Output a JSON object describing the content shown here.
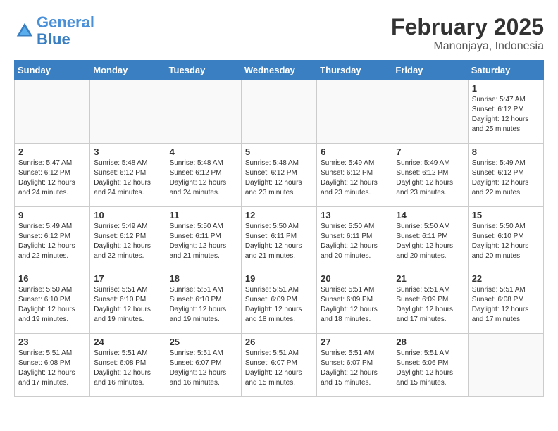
{
  "header": {
    "logo_line1": "General",
    "logo_line2": "Blue",
    "month": "February 2025",
    "location": "Manonjaya, Indonesia"
  },
  "days_of_week": [
    "Sunday",
    "Monday",
    "Tuesday",
    "Wednesday",
    "Thursday",
    "Friday",
    "Saturday"
  ],
  "weeks": [
    [
      {
        "day": "",
        "info": ""
      },
      {
        "day": "",
        "info": ""
      },
      {
        "day": "",
        "info": ""
      },
      {
        "day": "",
        "info": ""
      },
      {
        "day": "",
        "info": ""
      },
      {
        "day": "",
        "info": ""
      },
      {
        "day": "1",
        "info": "Sunrise: 5:47 AM\nSunset: 6:12 PM\nDaylight: 12 hours\nand 25 minutes."
      }
    ],
    [
      {
        "day": "2",
        "info": "Sunrise: 5:47 AM\nSunset: 6:12 PM\nDaylight: 12 hours\nand 24 minutes."
      },
      {
        "day": "3",
        "info": "Sunrise: 5:48 AM\nSunset: 6:12 PM\nDaylight: 12 hours\nand 24 minutes."
      },
      {
        "day": "4",
        "info": "Sunrise: 5:48 AM\nSunset: 6:12 PM\nDaylight: 12 hours\nand 24 minutes."
      },
      {
        "day": "5",
        "info": "Sunrise: 5:48 AM\nSunset: 6:12 PM\nDaylight: 12 hours\nand 23 minutes."
      },
      {
        "day": "6",
        "info": "Sunrise: 5:49 AM\nSunset: 6:12 PM\nDaylight: 12 hours\nand 23 minutes."
      },
      {
        "day": "7",
        "info": "Sunrise: 5:49 AM\nSunset: 6:12 PM\nDaylight: 12 hours\nand 23 minutes."
      },
      {
        "day": "8",
        "info": "Sunrise: 5:49 AM\nSunset: 6:12 PM\nDaylight: 12 hours\nand 22 minutes."
      }
    ],
    [
      {
        "day": "9",
        "info": "Sunrise: 5:49 AM\nSunset: 6:12 PM\nDaylight: 12 hours\nand 22 minutes."
      },
      {
        "day": "10",
        "info": "Sunrise: 5:49 AM\nSunset: 6:12 PM\nDaylight: 12 hours\nand 22 minutes."
      },
      {
        "day": "11",
        "info": "Sunrise: 5:50 AM\nSunset: 6:11 PM\nDaylight: 12 hours\nand 21 minutes."
      },
      {
        "day": "12",
        "info": "Sunrise: 5:50 AM\nSunset: 6:11 PM\nDaylight: 12 hours\nand 21 minutes."
      },
      {
        "day": "13",
        "info": "Sunrise: 5:50 AM\nSunset: 6:11 PM\nDaylight: 12 hours\nand 20 minutes."
      },
      {
        "day": "14",
        "info": "Sunrise: 5:50 AM\nSunset: 6:11 PM\nDaylight: 12 hours\nand 20 minutes."
      },
      {
        "day": "15",
        "info": "Sunrise: 5:50 AM\nSunset: 6:10 PM\nDaylight: 12 hours\nand 20 minutes."
      }
    ],
    [
      {
        "day": "16",
        "info": "Sunrise: 5:50 AM\nSunset: 6:10 PM\nDaylight: 12 hours\nand 19 minutes."
      },
      {
        "day": "17",
        "info": "Sunrise: 5:51 AM\nSunset: 6:10 PM\nDaylight: 12 hours\nand 19 minutes."
      },
      {
        "day": "18",
        "info": "Sunrise: 5:51 AM\nSunset: 6:10 PM\nDaylight: 12 hours\nand 19 minutes."
      },
      {
        "day": "19",
        "info": "Sunrise: 5:51 AM\nSunset: 6:09 PM\nDaylight: 12 hours\nand 18 minutes."
      },
      {
        "day": "20",
        "info": "Sunrise: 5:51 AM\nSunset: 6:09 PM\nDaylight: 12 hours\nand 18 minutes."
      },
      {
        "day": "21",
        "info": "Sunrise: 5:51 AM\nSunset: 6:09 PM\nDaylight: 12 hours\nand 17 minutes."
      },
      {
        "day": "22",
        "info": "Sunrise: 5:51 AM\nSunset: 6:08 PM\nDaylight: 12 hours\nand 17 minutes."
      }
    ],
    [
      {
        "day": "23",
        "info": "Sunrise: 5:51 AM\nSunset: 6:08 PM\nDaylight: 12 hours\nand 17 minutes."
      },
      {
        "day": "24",
        "info": "Sunrise: 5:51 AM\nSunset: 6:08 PM\nDaylight: 12 hours\nand 16 minutes."
      },
      {
        "day": "25",
        "info": "Sunrise: 5:51 AM\nSunset: 6:07 PM\nDaylight: 12 hours\nand 16 minutes."
      },
      {
        "day": "26",
        "info": "Sunrise: 5:51 AM\nSunset: 6:07 PM\nDaylight: 12 hours\nand 15 minutes."
      },
      {
        "day": "27",
        "info": "Sunrise: 5:51 AM\nSunset: 6:07 PM\nDaylight: 12 hours\nand 15 minutes."
      },
      {
        "day": "28",
        "info": "Sunrise: 5:51 AM\nSunset: 6:06 PM\nDaylight: 12 hours\nand 15 minutes."
      },
      {
        "day": "",
        "info": ""
      }
    ]
  ]
}
